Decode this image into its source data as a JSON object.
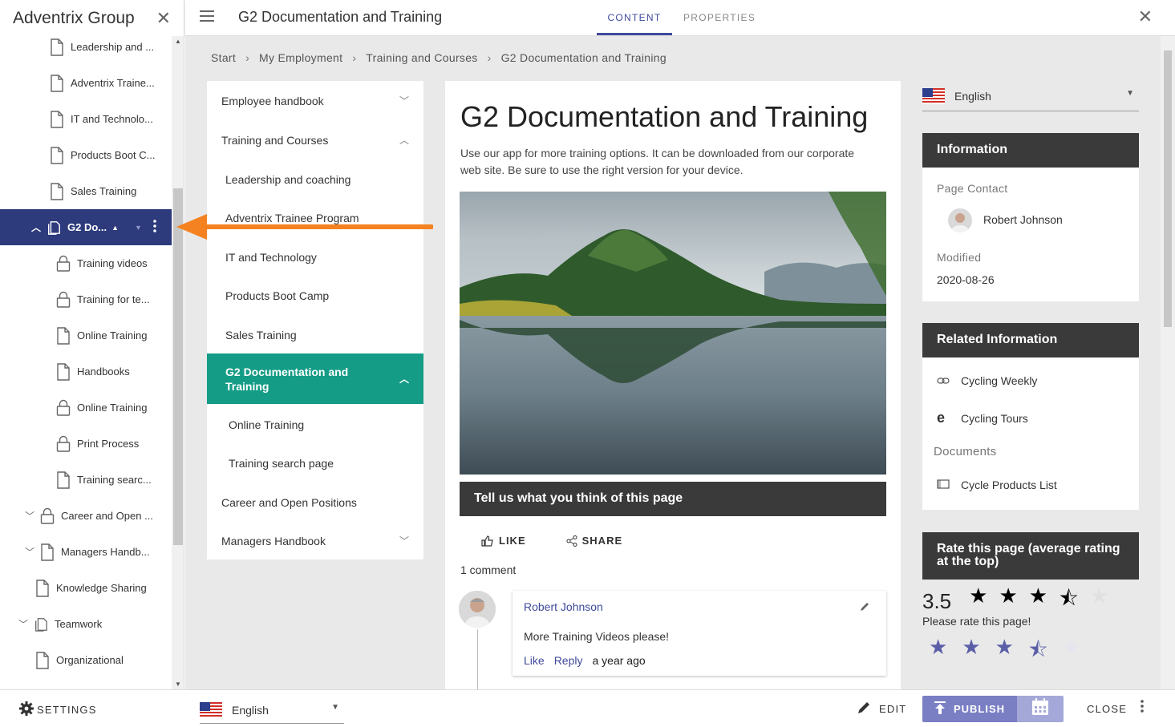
{
  "tree": {
    "title": "Adventrix Group",
    "items": [
      {
        "label": "Leadership and ..."
      },
      {
        "label": "Adventrix Traine..."
      },
      {
        "label": "IT and Technolo..."
      },
      {
        "label": "Products Boot C..."
      },
      {
        "label": "Sales Training"
      },
      {
        "label": "G2 Do..."
      },
      {
        "label": "Training videos"
      },
      {
        "label": "Training for te..."
      },
      {
        "label": "Online Training"
      },
      {
        "label": "Handbooks"
      },
      {
        "label": "Online Training"
      },
      {
        "label": "Print Process"
      },
      {
        "label": "Training searc..."
      },
      {
        "label": "Career and Open ..."
      },
      {
        "label": "Managers Handb..."
      },
      {
        "label": "Knowledge Sharing"
      },
      {
        "label": "Teamwork"
      },
      {
        "label": "Organizational"
      }
    ]
  },
  "header": {
    "title": "G2 Documentation and Training",
    "tabs": [
      {
        "label": "CONTENT"
      },
      {
        "label": "PROPERTIES"
      }
    ]
  },
  "breadcrumb": [
    "Start",
    "My Employment",
    "Training and Courses",
    "G2 Documentation and Training"
  ],
  "nav": {
    "items": [
      {
        "label": "Employee handbook"
      },
      {
        "label": "Training and Courses"
      },
      {
        "label": "Leadership and coaching"
      },
      {
        "label": "Adventrix Trainee Program"
      },
      {
        "label": "IT and Technology"
      },
      {
        "label": "Products Boot Camp"
      },
      {
        "label": "Sales Training"
      },
      {
        "label": "G2 Documentation and Training"
      },
      {
        "label": "Online Training"
      },
      {
        "label": "Training search page"
      },
      {
        "label": "Career and Open Positions"
      },
      {
        "label": "Managers Handbook"
      }
    ]
  },
  "content": {
    "title": "G2 Documentation and Training",
    "intro": "Use our app for more training options. It can be downloaded from our corporate web site. Be sure to use the right version for your device.",
    "feedback_label": "Tell us what you think of this page",
    "like_label": "LIKE",
    "share_label": "SHARE",
    "comment_count": "1 comment",
    "comment": {
      "author": "Robert Johnson",
      "text": "More Training Videos please!",
      "like": "Like",
      "reply": "Reply",
      "time": "a year ago"
    }
  },
  "sidebar": {
    "language": "English",
    "information": {
      "title": "Information",
      "contact_label": "Page Contact",
      "contact_name": "Robert Johnson",
      "modified_label": "Modified",
      "modified_value": "2020-08-26"
    },
    "related": {
      "title": "Related Information",
      "links": [
        {
          "label": "Cycling Weekly",
          "icon": "link-icon"
        },
        {
          "label": "Cycling Tours",
          "icon": "edge-icon"
        }
      ],
      "documents_label": "Documents",
      "documents": [
        {
          "label": "Cycle Products List",
          "icon": "list-icon"
        }
      ]
    },
    "rating": {
      "title": "Rate this page (average rating at the top)",
      "average": "3.5",
      "average_value": 3.5,
      "prompt": "Please rate this page!",
      "max": 5
    }
  },
  "bottom": {
    "settings_label": "SETTINGS",
    "language": "English",
    "edit_label": "EDIT",
    "publish_label": "PUBLISH",
    "close_label": "CLOSE"
  },
  "colors": {
    "accent": "#3f4a9c",
    "selected_tree": "#2d3a7c",
    "active_nav": "#149c86",
    "arrow": "#f58220",
    "panel_head": "#3a3a3a",
    "publish": "#7a7fc4"
  }
}
